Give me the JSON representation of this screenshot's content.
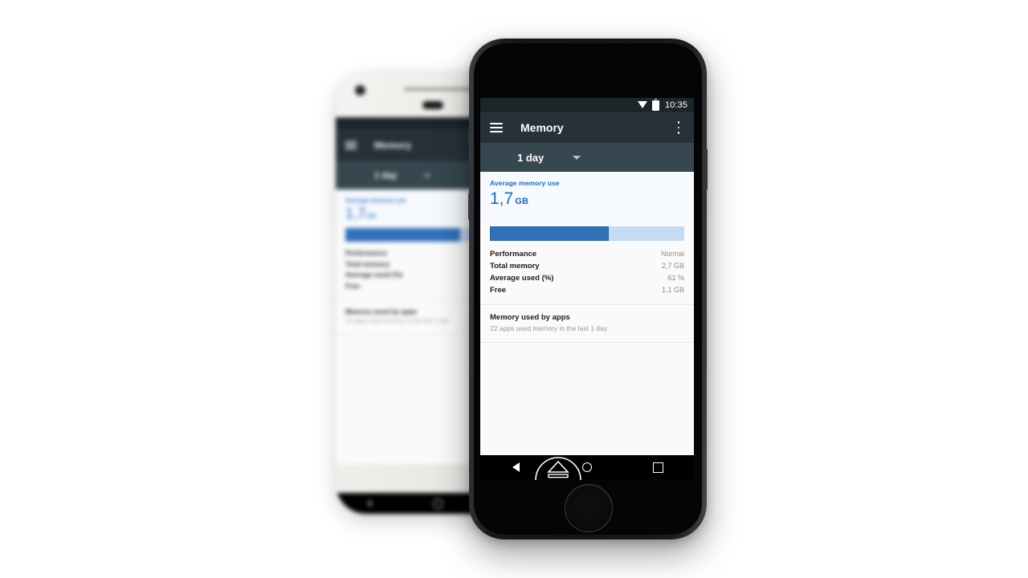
{
  "scene": {
    "background_color": "#ffffff",
    "devices": [
      {
        "name": "background-phone",
        "style": "white",
        "focus": "blurred"
      },
      {
        "name": "foreground-phone",
        "style": "black",
        "focus": "sharp"
      }
    ]
  },
  "status_bar": {
    "clock": "10:35",
    "wifi_icon": "wifi-icon",
    "battery_icon": "battery-icon"
  },
  "app_bar": {
    "menu_icon": "hamburger-menu-icon",
    "title": "Memory",
    "overflow_icon": "overflow-menu-icon",
    "background_color": "#263238"
  },
  "sub_bar": {
    "range_label": "1 day",
    "caret_icon": "chevron-down-icon",
    "background_color": "#37474f"
  },
  "hero": {
    "label": "Average memory use",
    "value": "1,7",
    "unit": "GB",
    "accent_color": "#1a6ac9",
    "background_color": "#f7fafd"
  },
  "usage_bar": {
    "fill_percent": 61,
    "fill_color": "#3072b9",
    "track_color": "#c3dcf4"
  },
  "stats": {
    "rows": [
      {
        "label": "Performance",
        "value": "Normal"
      },
      {
        "label": "Total memory",
        "value": "2,7 GB"
      },
      {
        "label": "Average used (%)",
        "value": "61 %"
      },
      {
        "label": "Free",
        "value": "1,1 GB"
      }
    ]
  },
  "apps_section": {
    "title": "Memory used by apps",
    "subtitle": "22 apps used memory in the last 1 day"
  },
  "nav_bar": {
    "back_icon": "back-triangle-icon",
    "home_icon": "home-circle-icon",
    "recents_icon": "recents-square-icon",
    "eject_overlay_icon": "eject-arc-icon"
  },
  "hardware": {
    "home_button": "home-button",
    "front_camera": "front-camera",
    "earpiece_speaker": "earpiece-speaker",
    "power_button": "power-button",
    "volume_up_button": "volume-up-button",
    "volume_down_button": "volume-down-button",
    "silent_switch": "silent-switch"
  }
}
